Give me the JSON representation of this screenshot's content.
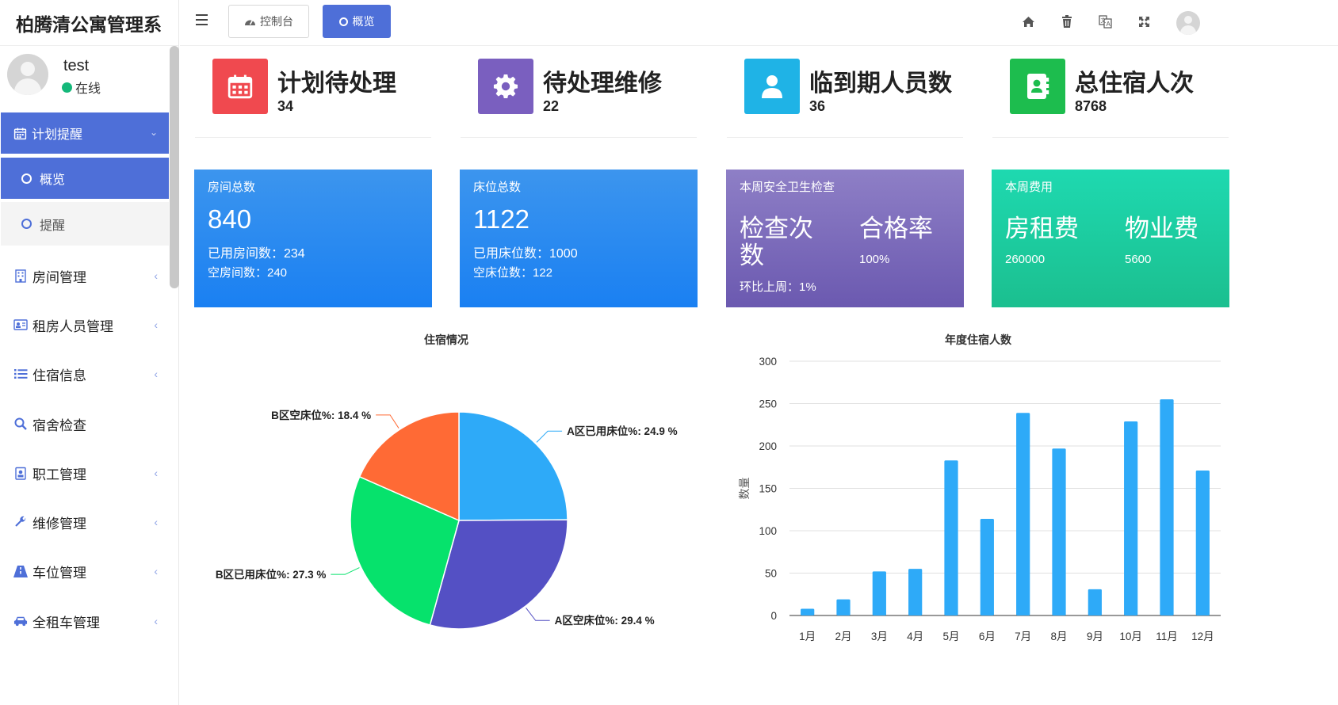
{
  "app": {
    "title": "柏腾清公寓管理系"
  },
  "user": {
    "name": "test",
    "status": "在线"
  },
  "sidebar": {
    "active_menu": "计划提醒",
    "active_sub": "概览",
    "sub_item": "提醒",
    "items": [
      {
        "label": "房间管理",
        "icon": "building-icon",
        "chevron": true
      },
      {
        "label": "租房人员管理",
        "icon": "id-card-icon",
        "chevron": true
      },
      {
        "label": "住宿信息",
        "icon": "list-icon",
        "chevron": true
      },
      {
        "label": "宿舍检查",
        "icon": "search-icon",
        "chevron": false
      },
      {
        "label": "职工管理",
        "icon": "badge-icon",
        "chevron": true
      },
      {
        "label": "维修管理",
        "icon": "wrench-icon",
        "chevron": true
      },
      {
        "label": "车位管理",
        "icon": "road-icon",
        "chevron": true
      },
      {
        "label": "全租车管理",
        "icon": "car-icon",
        "chevron": true
      }
    ]
  },
  "topbar": {
    "tabs": [
      {
        "label": "控制台"
      },
      {
        "label": "概览"
      }
    ],
    "icons": [
      "home-icon",
      "trash-icon",
      "translate-icon",
      "fullscreen-icon"
    ]
  },
  "info_boxes": [
    {
      "title": "计划待处理",
      "value": "34",
      "color": "#f0494f",
      "icon": "calendar-icon"
    },
    {
      "title": "待处理维修",
      "value": "22",
      "color": "#7a5fbf",
      "icon": "gear-icon"
    },
    {
      "title": "临到期人员数",
      "value": "36",
      "color": "#1fb3e6",
      "icon": "user-icon"
    },
    {
      "title": "总住宿人次",
      "value": "8768",
      "color": "#1dbd4e",
      "icon": "contact-book-icon"
    }
  ],
  "cards": {
    "rooms": {
      "title": "房间总数",
      "value": "840",
      "line1": "已用房间数：234",
      "line2": "空房间数：240"
    },
    "beds": {
      "title": "床位总数",
      "value": "1122",
      "line1": "已用床位数：1000",
      "line2": "空床位数：122"
    },
    "safety": {
      "title": "本周安全卫生检查",
      "col1_label": "检查次数",
      "col2_label": "合格率",
      "col2_value": "100%",
      "footer": "环比上周：1%"
    },
    "fees": {
      "title": "本周费用",
      "col1_label": "房租费",
      "col1_value": "260000",
      "col2_label": "物业费",
      "col2_value": "5600"
    }
  },
  "chart_data": [
    {
      "type": "pie",
      "title": "住宿情况",
      "slices": [
        {
          "name": "A区已用床位",
          "label": "A区已用床位%: 24.9 %",
          "value": 24.9,
          "color": "#2eaaf8"
        },
        {
          "name": "A区空床位",
          "label": "A区空床位%: 29.4 %",
          "value": 29.4,
          "color": "#5450c4"
        },
        {
          "name": "B区已用床位",
          "label": "B区已用床位%: 27.3 %",
          "value": 27.3,
          "color": "#06e26c"
        },
        {
          "name": "B区空床位",
          "label": "B区空床位%: 18.4 %",
          "value": 18.4,
          "color": "#ff6a35"
        }
      ]
    },
    {
      "type": "bar",
      "title": "年度住宿人数",
      "ylabel": "数量",
      "xlabel": "",
      "ylim": [
        0,
        300
      ],
      "yticks": [
        0,
        50,
        100,
        150,
        200,
        250,
        300
      ],
      "categories": [
        "1月",
        "2月",
        "3月",
        "4月",
        "5月",
        "6月",
        "7月",
        "8月",
        "9月",
        "10月",
        "11月",
        "12月"
      ],
      "values": [
        8,
        19,
        52,
        55,
        183,
        114,
        239,
        197,
        31,
        229,
        255,
        171
      ],
      "color": "#2eaaf8",
      "grid": true
    }
  ]
}
